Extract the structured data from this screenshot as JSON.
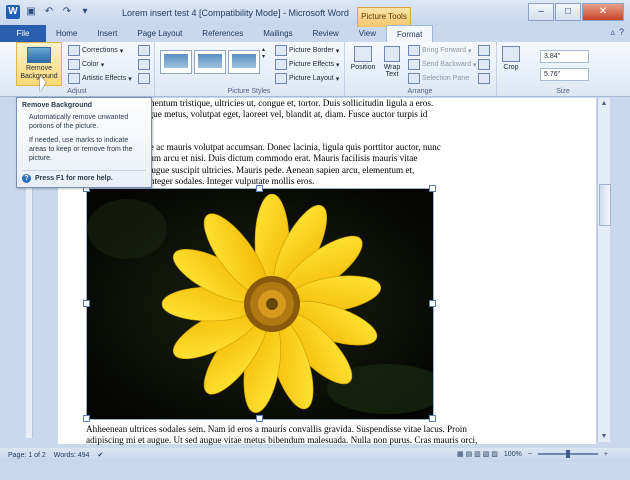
{
  "window": {
    "title": "Lorem insert test 4 [Compatibility Mode] - Microsoft Word",
    "context_tab": "Picture Tools",
    "controls": [
      "–",
      "□",
      "✕"
    ]
  },
  "tabs": [
    "File",
    "Home",
    "Insert",
    "Page Layout",
    "References",
    "Mailings",
    "Review",
    "View",
    "Format"
  ],
  "active_tab": "Format",
  "ribbon": {
    "remove_background": "Remove Background",
    "adjust": {
      "corrections": "Corrections",
      "color": "Color",
      "artistic": "Artistic Effects",
      "label": "Adjust"
    },
    "picture_styles": {
      "border": "Picture Border",
      "effects": "Picture Effects",
      "layout": "Picture Layout",
      "label": "Picture Styles"
    },
    "arrange": {
      "position": "Position",
      "wrap": "Wrap Text",
      "bring_forward": "Bring Forward",
      "send_backward": "Send Backward",
      "selection_pane": "Selection Pane",
      "label": "Arrange"
    },
    "size": {
      "crop": "Crop",
      "height": "3.84\"",
      "width": "5.76\"",
      "label": "Size"
    }
  },
  "tooltip": {
    "title": "Remove Background",
    "line1": "Automatically remove unwanted portions of the picture.",
    "line2": "If needed, use marks to indicate areas to keep or remove from the picture.",
    "help": "Press F1 for more help."
  },
  "document": {
    "para1_line1": "sapien quam, elementum tristique, ultricies ut, congue et, tortor. Duis sollicitudin ligula a eros.",
    "para1_line2": "volutpat. Cras augue metus, volutpat eget, laoreet vel, blandit at, diam. Fusce auctor turpis id",
    "para2_line1": "Aenean vitae pede ac mauris volutpat accumsan. Donec lacinia, ligula quis porttitor auctor, nunc",
    "para2_line2": "cu, at suscipit ipsum arcu et nisi. Duis dictum commodo erat. Mauris facilisis mauris vitae",
    "para2_line3": "ut enim sit amet augue suscipit ultricies. Mauris pede. Aenean sapien arcu, elementum et,",
    "para2_line4": "r sit amet, risus. Integer sodales. Integer vulputate mollis eros.",
    "para3_line1": "Ahheenean ultrices sodales sem. Nam id eros a mauris convallis gravida. Suspendisse vitae lacus. Proin",
    "para3_line2": "adipiscing mi et augue. Ut sed augue vitae metus bibendum malesuada. Nulla non purus. Cras mauris orci,"
  },
  "status": {
    "page": "Page: 1 of 2",
    "words": "Words: 494",
    "zoom": "100%"
  }
}
